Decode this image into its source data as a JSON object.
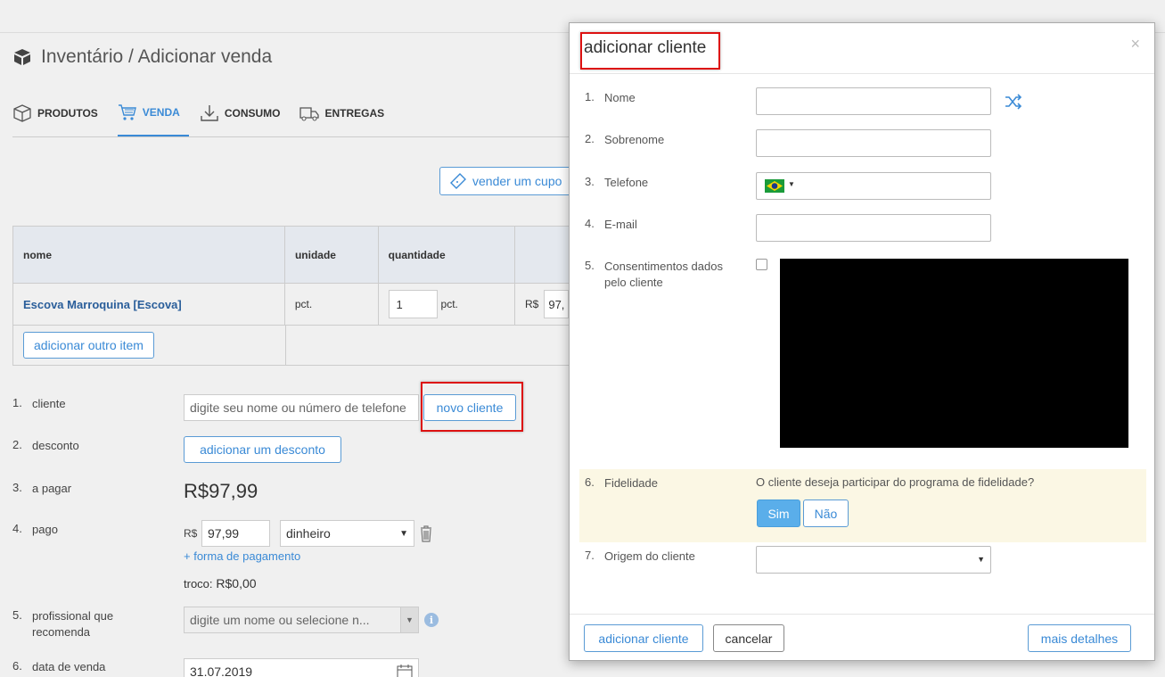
{
  "page": {
    "breadcrumb": "Inventário / Adicionar venda",
    "tabs": [
      {
        "label": "PRODUTOS",
        "icon": "cube-icon"
      },
      {
        "label": "VENDA",
        "icon": "cart-icon"
      },
      {
        "label": "CONSUMO",
        "icon": "download-icon"
      },
      {
        "label": "ENTREGAS",
        "icon": "truck-icon"
      }
    ],
    "coupon_button": "vender um cupo",
    "table": {
      "headers": [
        "nome",
        "unidade",
        "quantidade",
        ""
      ],
      "rows": [
        {
          "name": "Escova Marroquina [Escova]",
          "unit": "pct.",
          "qty": "1",
          "qty_unit": "pct.",
          "price_prefix": "R$",
          "price": "97,"
        }
      ],
      "add_item": "adicionar outro item"
    },
    "form": {
      "rows": [
        {
          "num": "1.",
          "label": "cliente"
        },
        {
          "num": "2.",
          "label": "desconto"
        },
        {
          "num": "3.",
          "label": "a pagar"
        },
        {
          "num": "4.",
          "label": "pago"
        },
        {
          "num": "5.",
          "label": "profissional que recomenda"
        },
        {
          "num": "6.",
          "label": "data de venda"
        }
      ],
      "client_placeholder": "digite seu nome ou número de telefone",
      "new_client_button": "novo cliente",
      "discount_button": "adicionar um desconto",
      "amount_due": "R$97,99",
      "paid_currency": "R$",
      "paid_value": "97,99",
      "payment_method": "dinheiro",
      "add_payment": "+ forma de pagamento",
      "change_label": "troco:",
      "change_value": "R$0,00",
      "professional_placeholder": "digite um nome ou selecione n...",
      "sale_date": "31.07.2019"
    }
  },
  "modal": {
    "title": "adicionar cliente",
    "fields": [
      {
        "num": "1.",
        "label": "Nome"
      },
      {
        "num": "2.",
        "label": "Sobrenome"
      },
      {
        "num": "3.",
        "label": "Telefone"
      },
      {
        "num": "4.",
        "label": "E-mail"
      },
      {
        "num": "5.",
        "label": "Consentimentos dados pelo cliente"
      },
      {
        "num": "6.",
        "label": "Fidelidade"
      },
      {
        "num": "7.",
        "label": "Origem do cliente"
      }
    ],
    "loyalty_question": "O cliente deseja participar do programa de fidelidade?",
    "yes": "Sim",
    "no": "Não",
    "add_button": "adicionar cliente",
    "cancel_button": "cancelar",
    "more_details": "mais detalhes",
    "close": "×"
  },
  "colors": {
    "accent": "#3a8ad6",
    "highlight_border": "#dd1111",
    "loyalty_bg": "#fbf7e4"
  }
}
